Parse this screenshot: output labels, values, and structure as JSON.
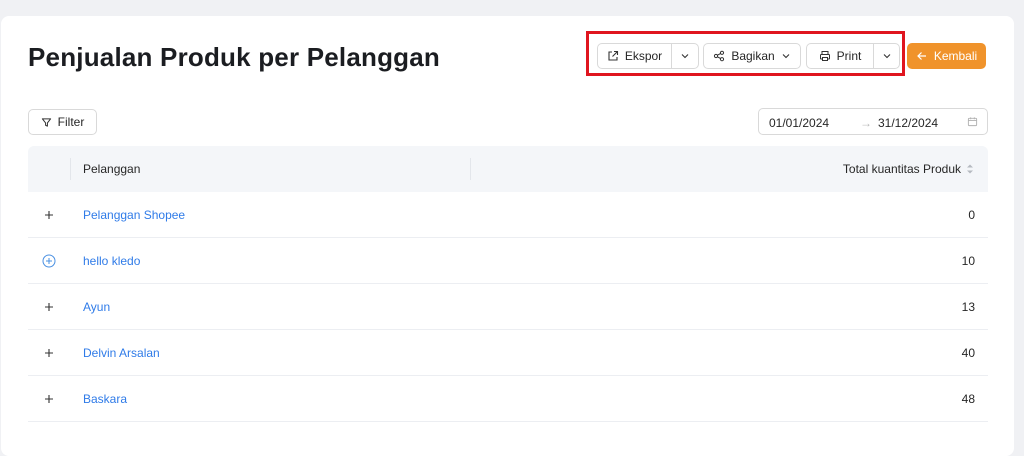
{
  "page": {
    "title": "Penjualan Produk per Pelanggan"
  },
  "toolbar": {
    "export_label": "Ekspor",
    "share_label": "Bagikan",
    "print_label": "Print",
    "back_label": "Kembali"
  },
  "filter": {
    "label": "Filter"
  },
  "date_range": {
    "start": "01/01/2024",
    "end": "31/12/2024",
    "separator": "→"
  },
  "table": {
    "columns": [
      "Pelanggan",
      "Total kuantitas Produk"
    ],
    "rows": [
      {
        "customer": "Pelanggan Shopee",
        "quantity": "0"
      },
      {
        "customer": "hello kledo",
        "quantity": "10"
      },
      {
        "customer": "Ayun",
        "quantity": "13"
      },
      {
        "customer": "Delvin Arsalan",
        "quantity": "40"
      },
      {
        "customer": "Baskara",
        "quantity": "48"
      }
    ]
  },
  "colors": {
    "accent": "#f0932b",
    "link": "#2f7be8",
    "highlight": "#e0151f"
  },
  "icons": {
    "export": "external-link-icon",
    "share": "share-icon",
    "print": "printer-icon",
    "back": "arrow-left-icon",
    "filter": "funnel-icon",
    "calendar": "calendar-icon",
    "sort": "sort-icon",
    "expand": "plus-icon"
  }
}
